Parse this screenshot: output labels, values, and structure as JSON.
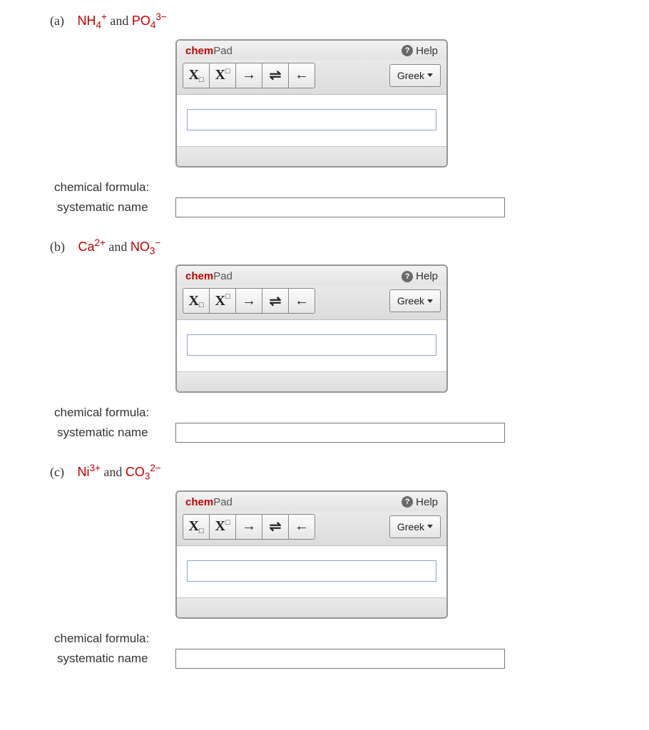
{
  "chempad": {
    "title_chem": "chem",
    "title_pad": "Pad",
    "help_label": "Help",
    "greek_label": "Greek",
    "btn_sub_main": "X",
    "btn_sub_box": "□",
    "btn_sup_main": "X",
    "btn_sup_box": "□",
    "btn_right_arrow": "→",
    "btn_equilibrium": "⇌",
    "btn_left_arrow": "←"
  },
  "labels": {
    "chemical_formula": "chemical formula:",
    "systematic_name": "systematic name",
    "and": "and"
  },
  "parts": [
    {
      "marker": "(a)",
      "ion1": {
        "base": "NH",
        "sub": "4",
        "sup": "+"
      },
      "ion2": {
        "base": "PO",
        "sub": "4",
        "sup": "3−"
      }
    },
    {
      "marker": "(b)",
      "ion1": {
        "base": "Ca",
        "sub": "",
        "sup": "2+"
      },
      "ion2": {
        "base": "NO",
        "sub": "3",
        "sup": "−"
      }
    },
    {
      "marker": "(c)",
      "ion1": {
        "base": "Ni",
        "sub": "",
        "sup": "3+"
      },
      "ion2": {
        "base": "CO",
        "sub": "3",
        "sup": "2−"
      }
    }
  ]
}
